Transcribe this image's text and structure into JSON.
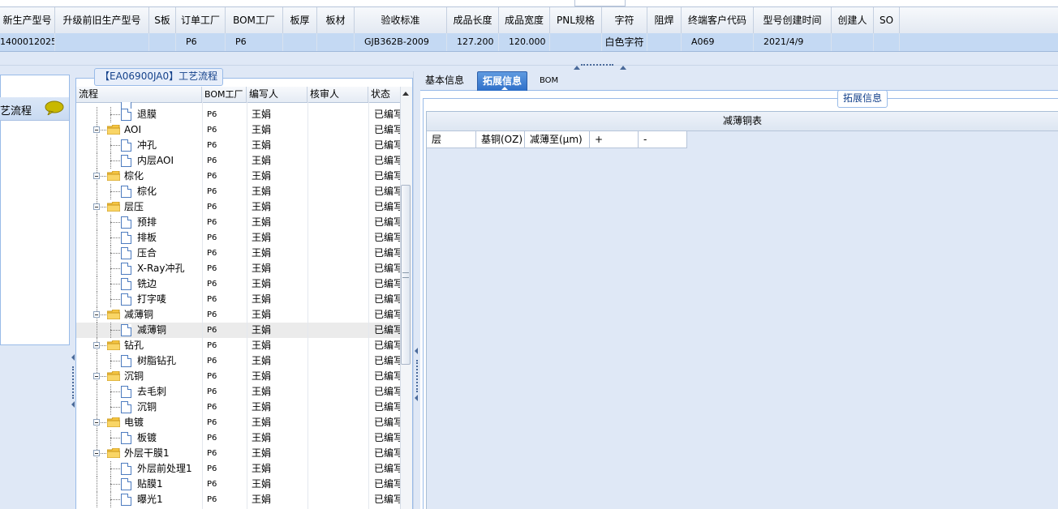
{
  "grid": {
    "headers": [
      "新生产型号",
      "升级前旧生产型号",
      "S板",
      "订单工厂",
      "BOM工厂",
      "板厚",
      "板材",
      "验收标准",
      "成品长度",
      "成品宽度",
      "PNL规格",
      "字符",
      "阻焊",
      "终端客户代码",
      "型号创建时间",
      "创建人",
      "SO"
    ],
    "row": [
      "1400012025",
      "",
      "",
      "P6",
      "P6",
      "",
      "",
      "GJB362B-2009",
      "127.200",
      "120.000",
      "",
      "白色字符",
      "",
      "A069",
      "2021/4/9",
      "",
      ""
    ]
  },
  "left_nav": {
    "item_label": "艺流程",
    "icon": "speech-bubble-icon"
  },
  "process_panel": {
    "legend": "【EA06900JA0】工艺流程",
    "columns": [
      "流程",
      "BOM工厂",
      "编写人",
      "核审人",
      "状态"
    ],
    "rows": [
      {
        "name": "退膜",
        "level": 2,
        "bom": "P6",
        "writer": "王娟",
        "reviewer": "",
        "status": "已编写"
      },
      {
        "name": "AOI",
        "level": 1,
        "bom": "P6",
        "writer": "王娟",
        "reviewer": "",
        "status": "已编写"
      },
      {
        "name": "冲孔",
        "level": 2,
        "bom": "P6",
        "writer": "王娟",
        "reviewer": "",
        "status": "已编写"
      },
      {
        "name": "内层AOI",
        "level": 2,
        "bom": "P6",
        "writer": "王娟",
        "reviewer": "",
        "status": "已编写"
      },
      {
        "name": "棕化",
        "level": 1,
        "bom": "P6",
        "writer": "王娟",
        "reviewer": "",
        "status": "已编写"
      },
      {
        "name": "棕化",
        "level": 2,
        "bom": "P6",
        "writer": "王娟",
        "reviewer": "",
        "status": "已编写"
      },
      {
        "name": "层压",
        "level": 1,
        "bom": "P6",
        "writer": "王娟",
        "reviewer": "",
        "status": "已编写"
      },
      {
        "name": "预排",
        "level": 2,
        "bom": "P6",
        "writer": "王娟",
        "reviewer": "",
        "status": "已编写"
      },
      {
        "name": "排板",
        "level": 2,
        "bom": "P6",
        "writer": "王娟",
        "reviewer": "",
        "status": "已编写"
      },
      {
        "name": "压合",
        "level": 2,
        "bom": "P6",
        "writer": "王娟",
        "reviewer": "",
        "status": "已编写"
      },
      {
        "name": "X-Ray冲孔",
        "level": 2,
        "bom": "P6",
        "writer": "王娟",
        "reviewer": "",
        "status": "已编写"
      },
      {
        "name": "铣边",
        "level": 2,
        "bom": "P6",
        "writer": "王娟",
        "reviewer": "",
        "status": "已编写"
      },
      {
        "name": "打字唛",
        "level": 2,
        "bom": "P6",
        "writer": "王娟",
        "reviewer": "",
        "status": "已编写"
      },
      {
        "name": "减薄铜",
        "level": 1,
        "bom": "P6",
        "writer": "王娟",
        "reviewer": "",
        "status": "已编写"
      },
      {
        "name": "减薄铜",
        "level": 2,
        "bom": "P6",
        "writer": "王娟",
        "reviewer": "",
        "status": "已编写",
        "selected": true
      },
      {
        "name": "钻孔",
        "level": 1,
        "bom": "P6",
        "writer": "王娟",
        "reviewer": "",
        "status": "已编写"
      },
      {
        "name": "树脂钻孔",
        "level": 2,
        "bom": "P6",
        "writer": "王娟",
        "reviewer": "",
        "status": "已编写"
      },
      {
        "name": "沉铜",
        "level": 1,
        "bom": "P6",
        "writer": "王娟",
        "reviewer": "",
        "status": "已编写"
      },
      {
        "name": "去毛刺",
        "level": 2,
        "bom": "P6",
        "writer": "王娟",
        "reviewer": "",
        "status": "已编写"
      },
      {
        "name": "沉铜",
        "level": 2,
        "bom": "P6",
        "writer": "王娟",
        "reviewer": "",
        "status": "已编写"
      },
      {
        "name": "电镀",
        "level": 1,
        "bom": "P6",
        "writer": "王娟",
        "reviewer": "",
        "status": "已编写"
      },
      {
        "name": "板镀",
        "level": 2,
        "bom": "P6",
        "writer": "王娟",
        "reviewer": "",
        "status": "已编写"
      },
      {
        "name": "外层干膜1",
        "level": 1,
        "bom": "P6",
        "writer": "王娟",
        "reviewer": "",
        "status": "已编写"
      },
      {
        "name": "外层前处理1",
        "level": 2,
        "bom": "P6",
        "writer": "王娟",
        "reviewer": "",
        "status": "已编写"
      },
      {
        "name": "贴膜1",
        "level": 2,
        "bom": "P6",
        "writer": "王娟",
        "reviewer": "",
        "status": "已编写"
      },
      {
        "name": "曝光1",
        "level": 2,
        "bom": "P6",
        "writer": "王娟",
        "reviewer": "",
        "status": "已编写"
      }
    ]
  },
  "tabs": [
    {
      "label": "基本信息",
      "active": false
    },
    {
      "label": "拓展信息",
      "active": true
    },
    {
      "label": "BOM",
      "active": false
    }
  ],
  "ext_info": {
    "legend": "拓展信息",
    "table_title": "减薄铜表",
    "columns": [
      "层",
      "基铜(OZ)",
      "减薄至(μm)",
      "+",
      "-"
    ]
  }
}
